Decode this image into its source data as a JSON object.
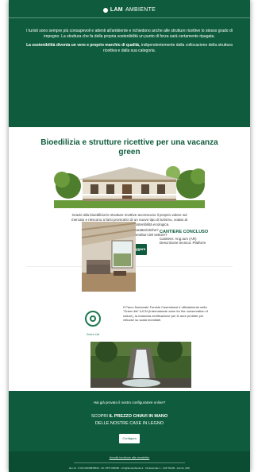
{
  "header": {
    "logo_bold": "LAM",
    "logo_rest": "AMBIENTE",
    "intro_p1": "I turisti sono sempre più consapevoli e attenti all'ambiente e richiedono anche alle strutture ricettive lo stesso grado di impegno. La struttura che fa della propria sostenibilità un punto di forza sarà certamente ripagata.",
    "intro_bold": "La sostenibilità diventa un vero e proprio marchio di qualità,",
    "intro_p2": "indipendentemente dalla collocazione della struttura ricettiva e dalla sua categoria."
  },
  "article": {
    "title": "Bioedilizia e strutture ricettive per una vacanza green",
    "body_l1": "Grazie alla bioedilizia le strutture ricettive accrescono il proprio valore sul",
    "body_l2": "mercato e riescono a farsi promotrici di un nuovo tipo di turismo, votato al",
    "body_l3": "rispetto dell'ambiente e alla sostenibilità ecologica.",
    "body_l4": "Ma quali sono le loro caratteristiche?",
    "body_l5": "E quali vantaggi per gli imprenditori del settore?",
    "button": "Continua a leggere"
  },
  "cantiere": {
    "title": "CANTIERE CONCLUSO",
    "line1": "Cantiere: Ang.tum (AR)",
    "line2": "Descrizione tecnica: Platform"
  },
  "park": {
    "logo_label": "Green List",
    "text": "Il Parco Nazionale Foreste Casentinesi è ufficialmente nella \"Green list\" IUCN (International union for the conservation of nature), la massima certificazione per le aree protette più virtuose su scala mondiale."
  },
  "footer": {
    "question": "Hai già provato il nostro configuratore online?",
    "line1_pre": "SCOPRI ",
    "line1_bold": "IL PREZZO CHIAVI IN MANO",
    "line2": "DELLE NOSTRE CASE IN LEGNO",
    "button": "Configura",
    "unsubscribe": "Annulla iscrizione alla newsletter",
    "legal": "lam srl - P.IVA 01900830509 - Tel. 0575 000000 - info@lamambiente.it - Via Example 1 - CAP 52100 - Arezzo (AR)"
  },
  "colors": {
    "brand_green": "#0e5c3d",
    "white": "#ffffff"
  },
  "icons": [
    "logo-mark-icon",
    "house-photo",
    "room-photo",
    "green-list-badge-icon",
    "waterfall-photo"
  ]
}
